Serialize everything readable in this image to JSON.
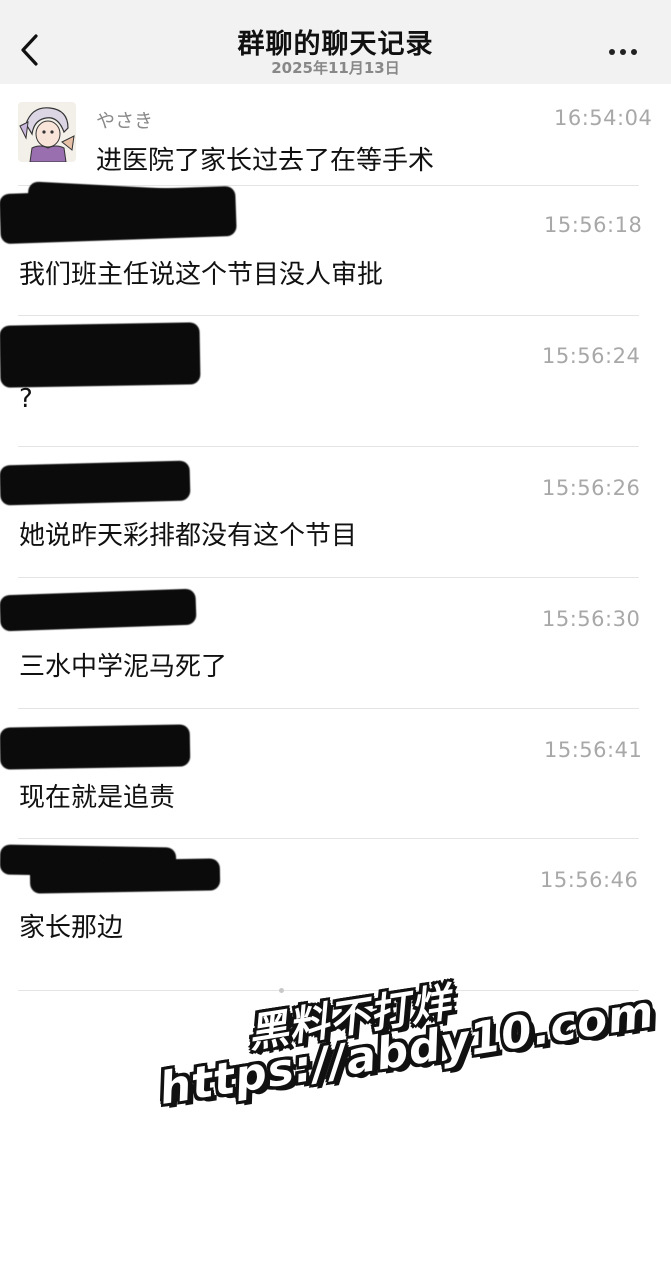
{
  "header": {
    "title": "群聊的聊天记录",
    "date": "2025年11月13日"
  },
  "messages": [
    {
      "sender": "やさき",
      "time": "16:54:04",
      "text": "进医院了家长过去了在等手术"
    },
    {
      "sender": "",
      "time": "15:56:18",
      "text": "我们班主任说这个节目没人审批"
    },
    {
      "sender": "",
      "time": "15:56:24",
      "text": "?"
    },
    {
      "sender": "",
      "time": "15:56:26",
      "text": "她说昨天彩排都没有这个节目"
    },
    {
      "sender": "",
      "time": "15:56:30",
      "text": "三水中学泥马死了"
    },
    {
      "sender": "",
      "time": "15:56:41",
      "text": "现在就是追责"
    },
    {
      "sender": "",
      "time": "15:56:46",
      "text": "家长那边"
    }
  ],
  "watermark": {
    "line1": "黑料不打烊",
    "line2": "https://abdy10.com"
  },
  "colors": {
    "header_bg": "#f2f2f2",
    "time_text": "#a8a8a8",
    "sender_text": "#8a8a8a",
    "redaction": "#0b0b0b"
  }
}
